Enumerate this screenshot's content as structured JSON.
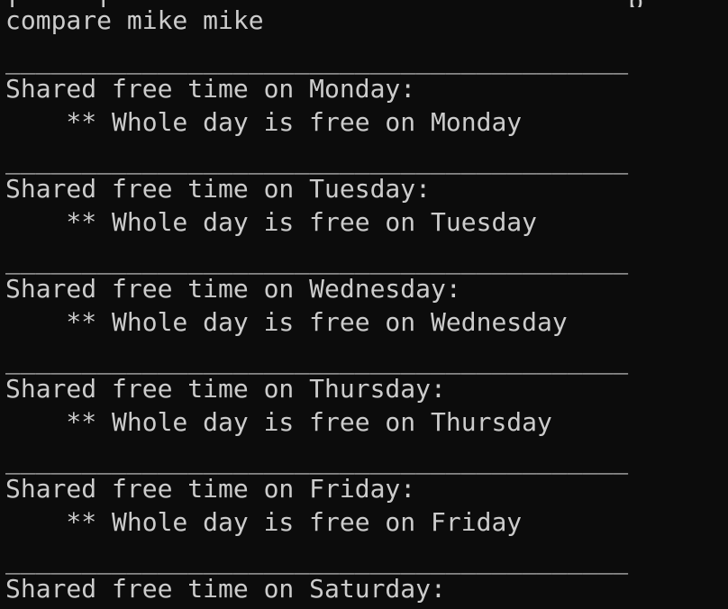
{
  "terminal": {
    "background": "#0c0c0c",
    "foreground": "#cccccc",
    "top_fragment": "[_____[__________________________________p___",
    "command": "compare mike mike",
    "separator": "_________________________________________",
    "blocks": [
      {
        "header": "Shared free time on Monday:",
        "detail": "    ** Whole day is free on Monday"
      },
      {
        "header": "Shared free time on Tuesday:",
        "detail": "    ** Whole day is free on Tuesday"
      },
      {
        "header": "Shared free time on Wednesday:",
        "detail": "    ** Whole day is free on Wednesday"
      },
      {
        "header": "Shared free time on Thursday:",
        "detail": "    ** Whole day is free on Thursday"
      },
      {
        "header": "Shared free time on Friday:",
        "detail": "    ** Whole day is free on Friday"
      },
      {
        "header": "Shared free time on Saturday:",
        "detail": ""
      }
    ]
  }
}
